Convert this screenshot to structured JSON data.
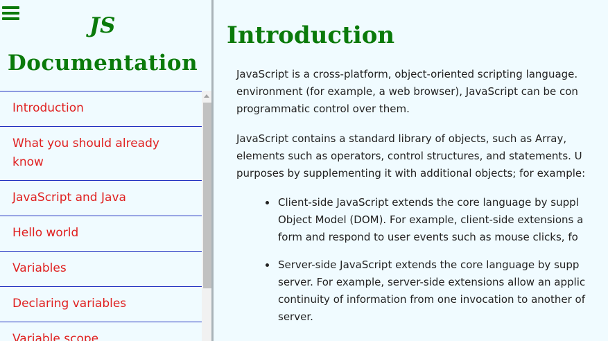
{
  "sidebar": {
    "title_line1": "JS",
    "title_line2": "Documentation",
    "menu_icon": "hamburger-menu-icon",
    "items": [
      {
        "label": "Introduction"
      },
      {
        "label": "What you should already know"
      },
      {
        "label": "JavaScript and Java"
      },
      {
        "label": "Hello world"
      },
      {
        "label": "Variables"
      },
      {
        "label": "Declaring variables"
      },
      {
        "label": "Variable scope"
      }
    ]
  },
  "main": {
    "title": "Introduction",
    "paragraph1": [
      "JavaScript is a cross-platform, object-oriented scripting language.",
      "environment (for example, a web browser), JavaScript can be con",
      "programmatic control over them."
    ],
    "paragraph2": [
      "JavaScript contains a standard library of objects, such as Array,",
      "elements such as operators, control structures, and statements. U",
      "purposes by supplementing it with additional objects; for example:"
    ],
    "bullets": [
      {
        "lines": [
          "Client-side JavaScript extends the core language by suppl",
          "Object Model (DOM). For example, client-side extensions a",
          "form and respond to user events such as mouse clicks, fo"
        ]
      },
      {
        "lines": [
          "Server-side JavaScript extends the core language by supp",
          "server. For example, server-side extensions allow an applic",
          "continuity of information from one invocation to another of",
          "server."
        ]
      }
    ]
  },
  "colors": {
    "title_green": "#0a7a0a",
    "nav_red": "#e02020",
    "nav_border_blue": "#2030c0",
    "background": "#f0fbff"
  }
}
